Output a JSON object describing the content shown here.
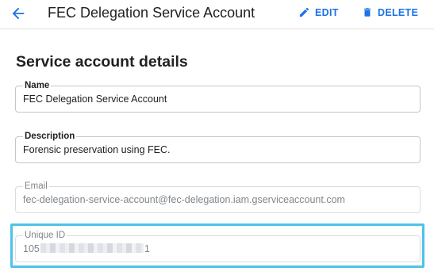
{
  "header": {
    "title": "FEC Delegation Service Account",
    "edit_label": "EDIT",
    "delete_label": "DELETE",
    "accent_color": "#1a73e8"
  },
  "section": {
    "title": "Service account details"
  },
  "fields": {
    "name": {
      "label": "Name",
      "value": "FEC Delegation Service Account"
    },
    "description": {
      "label": "Description",
      "value": "Forensic preservation using FEC."
    },
    "email": {
      "label": "Email",
      "value": "fec-delegation-service-account@fec-delegation.iam.gserviceaccount.com"
    },
    "unique_id": {
      "label": "Unique ID",
      "value_prefix": "105",
      "value_suffix": "1",
      "highlight_color": "#4dc3e8"
    }
  }
}
